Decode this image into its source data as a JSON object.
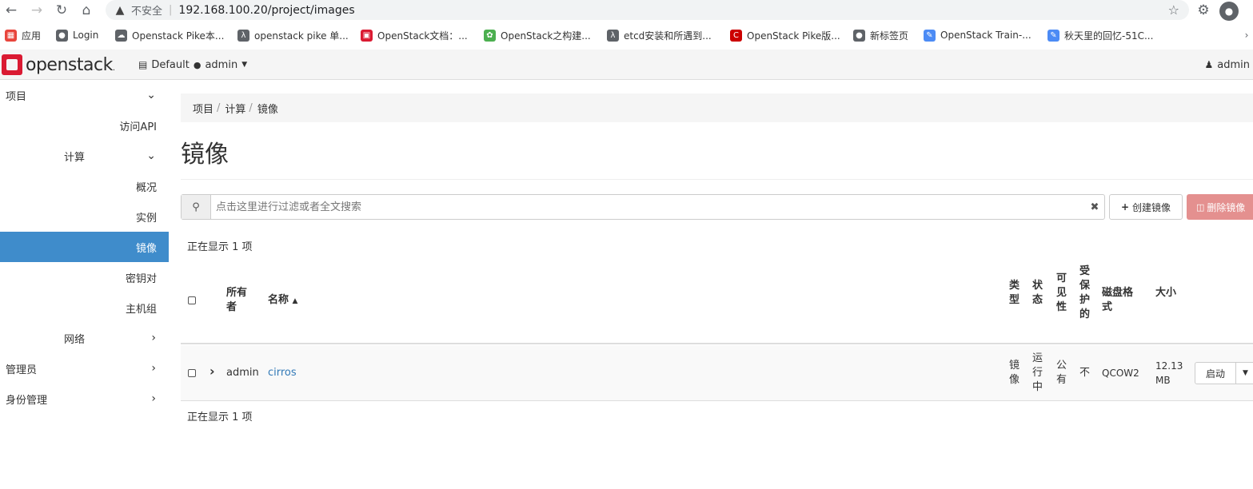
{
  "browser": {
    "security_label": "不安全",
    "separator": "|",
    "url": "192.168.100.20/project/images",
    "bookmarks": [
      {
        "label": "应用",
        "icon": "apps-grid-icon",
        "color": "#e8453c"
      },
      {
        "label": "Login",
        "icon": "globe-icon",
        "color": "#5f6368"
      },
      {
        "label": "Openstack Pike本...",
        "icon": "cloud-icon",
        "color": "#5f6368"
      },
      {
        "label": "openstack pike 单...",
        "icon": "lambda-icon",
        "color": "#5f6368"
      },
      {
        "label": "OpenStack文档：...",
        "icon": "openstack-icon",
        "color": "#da1a32"
      },
      {
        "label": "OpenStack之构建...",
        "icon": "leaf-icon",
        "color": "#4caf50"
      },
      {
        "label": "etcd安装和所遇到...",
        "icon": "lambda-icon",
        "color": "#5f6368"
      },
      {
        "label": "OpenStack Pike版...",
        "icon": "csdn-icon",
        "color": "#c00"
      },
      {
        "label": "新标签页",
        "icon": "globe-icon",
        "color": "#5f6368"
      },
      {
        "label": "OpenStack Train-...",
        "icon": "pen-icon",
        "color": "#4c8bf5"
      },
      {
        "label": "秋天里的回忆-51C...",
        "icon": "pen-icon",
        "color": "#4c8bf5"
      }
    ]
  },
  "header": {
    "logo_text": "openstack",
    "logo_mark": ".",
    "project_domain": "Default",
    "project_name": "admin",
    "user_name": "admin"
  },
  "sidebar": {
    "project": "项目",
    "access_api": "访问API",
    "compute": "计算",
    "overview": "概况",
    "instances": "实例",
    "images": "镜像",
    "key_pairs": "密钥对",
    "server_groups": "主机组",
    "network": "网络",
    "admin": "管理员",
    "identity": "身份管理"
  },
  "breadcrumb": [
    "项目",
    "计算",
    "镜像"
  ],
  "page_title": "镜像",
  "search": {
    "placeholder": "点击这里进行过滤或者全文搜索"
  },
  "actions": {
    "create": "创建镜像",
    "delete": "删除镜像"
  },
  "count_text": "正在显示 1 项",
  "table": {
    "headers": {
      "owner": "所有者",
      "name": "名称",
      "type": "类型",
      "status": "状态",
      "visibility": "可见性",
      "protected": "受保护的",
      "disk_format": "磁盘格式",
      "size": "大小"
    },
    "rows": [
      {
        "owner": "admin",
        "name": "cirros",
        "type": "镜像",
        "status": "运行中",
        "visibility": "公有",
        "protected": "不",
        "disk_format": "QCOW2",
        "size": "12.13 MB",
        "action": "启动"
      }
    ]
  }
}
